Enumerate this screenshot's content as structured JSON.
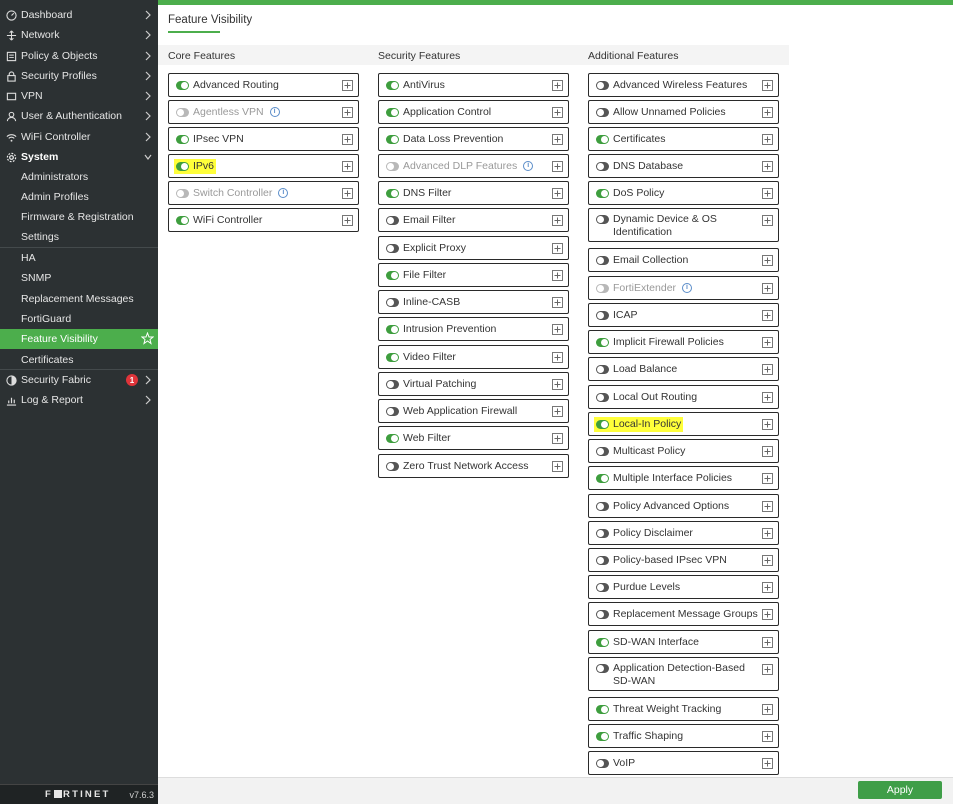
{
  "sidebar": {
    "items": [
      {
        "label": "Dashboard",
        "icon": "dashboard-icon"
      },
      {
        "label": "Network",
        "icon": "network-icon"
      },
      {
        "label": "Policy & Objects",
        "icon": "policy-icon"
      },
      {
        "label": "Security Profiles",
        "icon": "lock-icon"
      },
      {
        "label": "VPN",
        "icon": "vpn-icon"
      },
      {
        "label": "User & Authentication",
        "icon": "user-icon"
      },
      {
        "label": "WiFi Controller",
        "icon": "wifi-icon"
      },
      {
        "label": "System",
        "icon": "gear-icon"
      }
    ],
    "system_sub": [
      "Administrators",
      "Admin Profiles",
      "Firmware & Registration",
      "Settings",
      "HA",
      "SNMP",
      "Replacement Messages",
      "FortiGuard",
      "Feature Visibility",
      "Certificates"
    ],
    "bottom_items": [
      {
        "label": "Security Fabric",
        "icon": "fabric-icon",
        "badge": "1"
      },
      {
        "label": "Log & Report",
        "icon": "report-icon"
      }
    ],
    "brand": "F⁠RTINET",
    "version": "v7.6.3"
  },
  "page": {
    "title": "Feature Visibility",
    "apply_label": "Apply",
    "accent": "#4cae4c"
  },
  "columns": {
    "core": {
      "header": "Core Features",
      "items": [
        {
          "label": "Advanced Routing",
          "state": "on"
        },
        {
          "label": "Agentless VPN",
          "state": "disabled",
          "info": true
        },
        {
          "label": "IPsec VPN",
          "state": "on"
        },
        {
          "label": "IPv6",
          "state": "on",
          "highlight": true
        },
        {
          "label": "Switch Controller",
          "state": "disabled",
          "info": true
        },
        {
          "label": "WiFi Controller",
          "state": "on"
        }
      ]
    },
    "security": {
      "header": "Security Features",
      "items": [
        {
          "label": "AntiVirus",
          "state": "on"
        },
        {
          "label": "Application Control",
          "state": "on"
        },
        {
          "label": "Data Loss Prevention",
          "state": "on"
        },
        {
          "label": "Advanced DLP Features",
          "state": "disabled",
          "info": true
        },
        {
          "label": "DNS Filter",
          "state": "on"
        },
        {
          "label": "Email Filter",
          "state": "off"
        },
        {
          "label": "Explicit Proxy",
          "state": "off"
        },
        {
          "label": "File Filter",
          "state": "on"
        },
        {
          "label": "Inline-CASB",
          "state": "off"
        },
        {
          "label": "Intrusion Prevention",
          "state": "on"
        },
        {
          "label": "Video Filter",
          "state": "on"
        },
        {
          "label": "Virtual Patching",
          "state": "off"
        },
        {
          "label": "Web Application Firewall",
          "state": "off"
        },
        {
          "label": "Web Filter",
          "state": "on"
        },
        {
          "label": "Zero Trust Network Access",
          "state": "off"
        }
      ]
    },
    "additional": {
      "header": "Additional Features",
      "items": [
        {
          "label": "Advanced Wireless Features",
          "state": "off"
        },
        {
          "label": "Allow Unnamed Policies",
          "state": "off"
        },
        {
          "label": "Certificates",
          "state": "on"
        },
        {
          "label": "DNS Database",
          "state": "off"
        },
        {
          "label": "DoS Policy",
          "state": "on"
        },
        {
          "label": "Dynamic Device & OS Identification",
          "state": "off",
          "tall": true
        },
        {
          "label": "Email Collection",
          "state": "off"
        },
        {
          "label": "FortiExtender",
          "state": "disabled",
          "info": true
        },
        {
          "label": "ICAP",
          "state": "off"
        },
        {
          "label": "Implicit Firewall Policies",
          "state": "on"
        },
        {
          "label": "Load Balance",
          "state": "off"
        },
        {
          "label": "Local Out Routing",
          "state": "off"
        },
        {
          "label": "Local-In Policy",
          "state": "on",
          "highlight": true
        },
        {
          "label": "Multicast Policy",
          "state": "off"
        },
        {
          "label": "Multiple Interface Policies",
          "state": "on"
        },
        {
          "label": "Policy Advanced Options",
          "state": "off"
        },
        {
          "label": "Policy Disclaimer",
          "state": "off"
        },
        {
          "label": "Policy-based IPsec VPN",
          "state": "off"
        },
        {
          "label": "Purdue Levels",
          "state": "off"
        },
        {
          "label": "Replacement Message Groups",
          "state": "off"
        },
        {
          "label": "SD-WAN Interface",
          "state": "on"
        },
        {
          "label": "Application Detection-Based SD-WAN",
          "state": "off",
          "tall": true
        },
        {
          "label": "Threat Weight Tracking",
          "state": "on"
        },
        {
          "label": "Traffic Shaping",
          "state": "on"
        },
        {
          "label": "VoIP",
          "state": "off"
        }
      ]
    }
  }
}
